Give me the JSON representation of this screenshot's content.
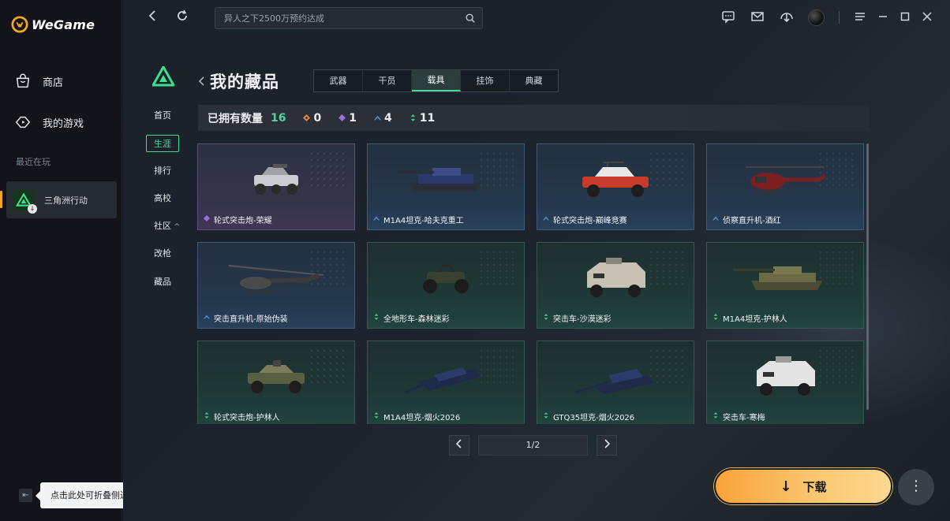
{
  "app": {
    "logo_text": "WeGame"
  },
  "sidebar": {
    "store_label": "商店",
    "my_games_label": "我的游戏",
    "recent_label": "最近在玩",
    "recent_game": "三角洲行动",
    "collapse_tip": "点击此处可折叠侧边栏"
  },
  "search": {
    "placeholder": "异人之下2500万预约达成"
  },
  "game_nav": {
    "items": [
      "首页",
      "生涯",
      "排行",
      "高校",
      "社区",
      "改枪",
      "藏品"
    ],
    "active": "生涯",
    "community_chevron": "^"
  },
  "collection": {
    "title": "我的藏品",
    "tabs": [
      "武器",
      "干员",
      "载具",
      "挂饰",
      "典藏"
    ],
    "active_tab": "载具",
    "owned_label": "已拥有数量",
    "owned_total": "16",
    "stats": [
      {
        "rarity": "orange",
        "color": "#e0873a",
        "count": "0"
      },
      {
        "rarity": "purple",
        "color": "#9b6ee0",
        "count": "1"
      },
      {
        "rarity": "blue",
        "color": "#4b8fe0",
        "count": "4"
      },
      {
        "rarity": "green",
        "color": "#3ec88a",
        "count": "11"
      }
    ],
    "items": [
      {
        "name": "轮式突击炮-荣耀",
        "rarity": "purple",
        "vehicle": "buggy"
      },
      {
        "name": "M1A4坦克-哈夫克重工",
        "rarity": "blue",
        "vehicle": "tank"
      },
      {
        "name": "轮式突击炮-巅峰竞赛",
        "rarity": "blue",
        "vehicle": "buggy-red"
      },
      {
        "name": "侦察直升机-酒红",
        "rarity": "blue",
        "vehicle": "heli"
      },
      {
        "name": "突击直升机-原始伪装",
        "rarity": "blue",
        "vehicle": "attack-heli"
      },
      {
        "name": "全地形车-森林迷彩",
        "rarity": "green",
        "vehicle": "atv"
      },
      {
        "name": "突击车-沙漠迷彩",
        "rarity": "green",
        "vehicle": "apc"
      },
      {
        "name": "M1A4坦克-护林人",
        "rarity": "green",
        "vehicle": "tank-camo"
      },
      {
        "name": "轮式突击炮-护林人",
        "rarity": "green",
        "vehicle": "buggy-camo"
      },
      {
        "name": "M1A4坦克-烟火2026",
        "rarity": "green",
        "vehicle": "tank-dark"
      },
      {
        "name": "GTQ35坦克-烟火2026",
        "rarity": "green",
        "vehicle": "tank-dark2"
      },
      {
        "name": "突击车-寒梅",
        "rarity": "green",
        "vehicle": "apc-white"
      }
    ],
    "page_text": "1/2"
  },
  "download": {
    "label": "下载",
    "arrow": "↓"
  },
  "more": {
    "label": "⋮"
  }
}
